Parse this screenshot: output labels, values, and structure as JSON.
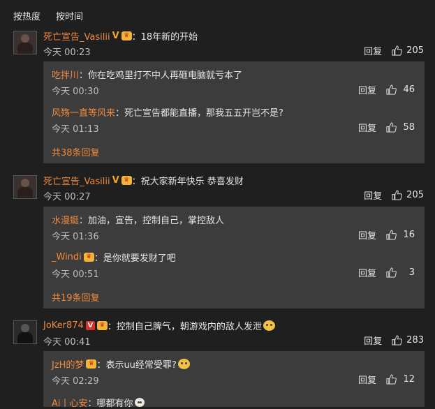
{
  "sort": {
    "hot": "按热度",
    "time": "按时间"
  },
  "comments": [
    {
      "user": "死亡宣告_Vasilii",
      "badge": "V",
      "text": "：18年新的开始",
      "time": "今天 00:23",
      "reply_label": "回复",
      "likes": "205",
      "replies": [
        {
          "user": "吃拌川",
          "text": "：你在吃鸡里打不中人再砸电脑就亏本了",
          "time": "今天 00:30",
          "reply_label": "回复",
          "likes": "46"
        },
        {
          "user": "风殇一直等风来",
          "text": "：死亡宣告都能直播，那我五五开岂不是?",
          "time": "今天 01:13",
          "reply_label": "回复",
          "likes": "58"
        }
      ],
      "more": "共38条回复"
    },
    {
      "user": "死亡宣告_Vasilii",
      "badge": "V",
      "text": "：祝大家新年快乐 恭喜发财",
      "time": "今天 00:27",
      "reply_label": "回复",
      "likes": "205",
      "replies": [
        {
          "user": "水漫蜓",
          "text": "：加油，宣告，控制自己，掌控敌人",
          "time": "今天 01:36",
          "reply_label": "回复",
          "likes": "16"
        },
        {
          "user": "_Windi",
          "text": "：是你就要发财了吧",
          "time": "今天 00:51",
          "reply_label": "回复",
          "likes": "3"
        }
      ],
      "more": "共19条回复"
    },
    {
      "user": "JoKer874",
      "badge": "V",
      "text": "：控制自己脾气，朝游戏内的敌人发泄",
      "time": "今天 00:41",
      "reply_label": "回复",
      "likes": "283",
      "replies": [
        {
          "user": "JzH的梦",
          "text": "：表示uu经常受罪?",
          "time": "今天 02:29",
          "reply_label": "回复",
          "likes": "12"
        },
        {
          "user": "Ai丨心安",
          "text": "：哪都有你",
          "time": "",
          "reply_label": "",
          "likes": ""
        }
      ]
    }
  ],
  "colors": {
    "accent": "#f08a3c",
    "bg": "#1f1f1f",
    "reply_bg": "#3c3c3c"
  },
  "icons": {
    "like": "thumbs-up-icon",
    "vip": "crown-icon",
    "verified": "v-badge-icon"
  }
}
